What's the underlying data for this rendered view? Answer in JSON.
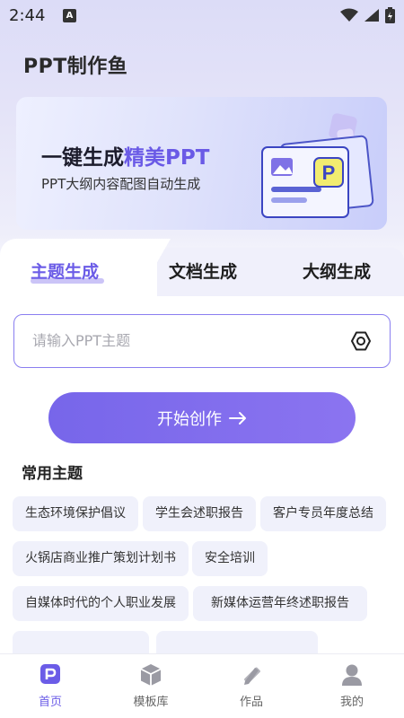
{
  "status_bar": {
    "time": "2:44",
    "notification_letter": "A"
  },
  "app": {
    "title": "PPT制作鱼"
  },
  "banner": {
    "headline_plain": "一键生成",
    "headline_accent": "精美PPT",
    "subtitle": "PPT大纲内容配图自动生成",
    "art_letter": "P"
  },
  "tabs": [
    {
      "label": "主题生成",
      "active": true
    },
    {
      "label": "文档生成",
      "active": false
    },
    {
      "label": "大纲生成",
      "active": false
    }
  ],
  "topic_input": {
    "placeholder": "请输入PPT主题",
    "value": "",
    "icon": "hexagon-settings-icon"
  },
  "start_button": {
    "label": "开始创作",
    "icon": "arrow-right-icon"
  },
  "common_topics": {
    "title": "常用主题",
    "items": [
      "生态环境保护倡议",
      "学生会述职报告",
      "客户专员年度总结",
      "火锅店商业推广策划计划书",
      "安全培训",
      "自媒体时代的个人职业发展",
      "新媒体运营年终述职报告"
    ]
  },
  "bottom_nav": [
    {
      "label": "首页",
      "icon": "home-ppt-icon",
      "active": true
    },
    {
      "label": "模板库",
      "icon": "cube-icon",
      "active": false
    },
    {
      "label": "作品",
      "icon": "pencil-ruler-icon",
      "active": false
    },
    {
      "label": "我的",
      "icon": "user-icon",
      "active": false
    }
  ],
  "colors": {
    "accent": "#6b5ce7",
    "chip_bg": "#f0f1fb"
  }
}
